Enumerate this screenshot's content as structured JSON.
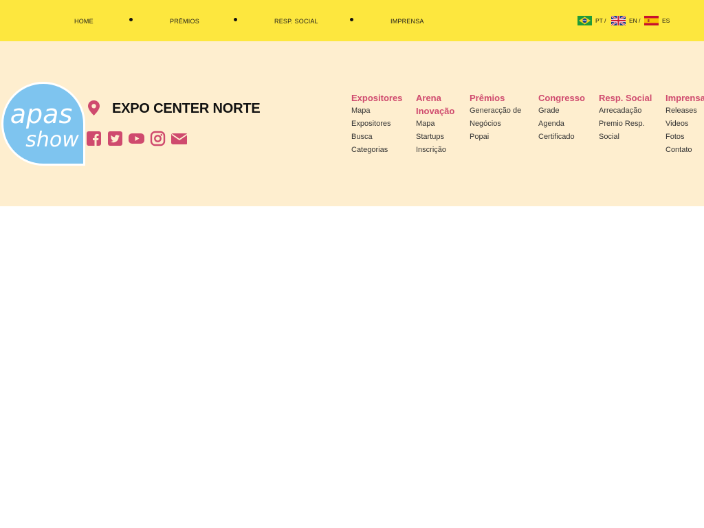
{
  "topnav": {
    "items": [
      "HOME",
      "PRÊMIOS",
      "RESP. SOCIAL",
      "IMPRENSA"
    ]
  },
  "languages": [
    {
      "code": "PT /",
      "flag": "brazil-flag-icon"
    },
    {
      "code": "EN /",
      "flag": "uk-flag-icon"
    },
    {
      "code": "ES",
      "flag": "spain-flag-icon"
    }
  ],
  "header": {
    "logo_text_top": "apas",
    "logo_text_bottom": "show",
    "venue": "EXPO CENTER NORTE",
    "social_icons": [
      "facebook-icon",
      "twitter-icon",
      "youtube-icon",
      "instagram-icon",
      "email-icon"
    ]
  },
  "nav": {
    "columns": [
      {
        "heading": [
          "Expositores"
        ],
        "items": [
          "Mapa",
          "Expositores",
          "Busca",
          "Categorias"
        ]
      },
      {
        "heading": [
          "Arena",
          "Inovação"
        ],
        "items": [
          "Mapa",
          "Startups",
          "Inscrição"
        ]
      },
      {
        "heading": [
          "Prêmios"
        ],
        "items": [
          "Generacção de",
          "Negócios",
          "Popai"
        ]
      },
      {
        "heading": [
          "Congresso"
        ],
        "items": [
          "Grade",
          "Agenda",
          "Certificado"
        ]
      },
      {
        "heading": [
          "Resp. Social"
        ],
        "items": [
          "Arrecadação",
          "Premio Resp.",
          "Social"
        ]
      },
      {
        "heading": [
          "Imprensa"
        ],
        "items": [
          "Releases",
          "Videos",
          "Fotos",
          "Contato"
        ]
      }
    ]
  },
  "colors": {
    "topbar": "#fde73e",
    "header_bg": "#feeecf",
    "accent": "#cf4a6e",
    "logo_blue": "#7ec4ef"
  }
}
